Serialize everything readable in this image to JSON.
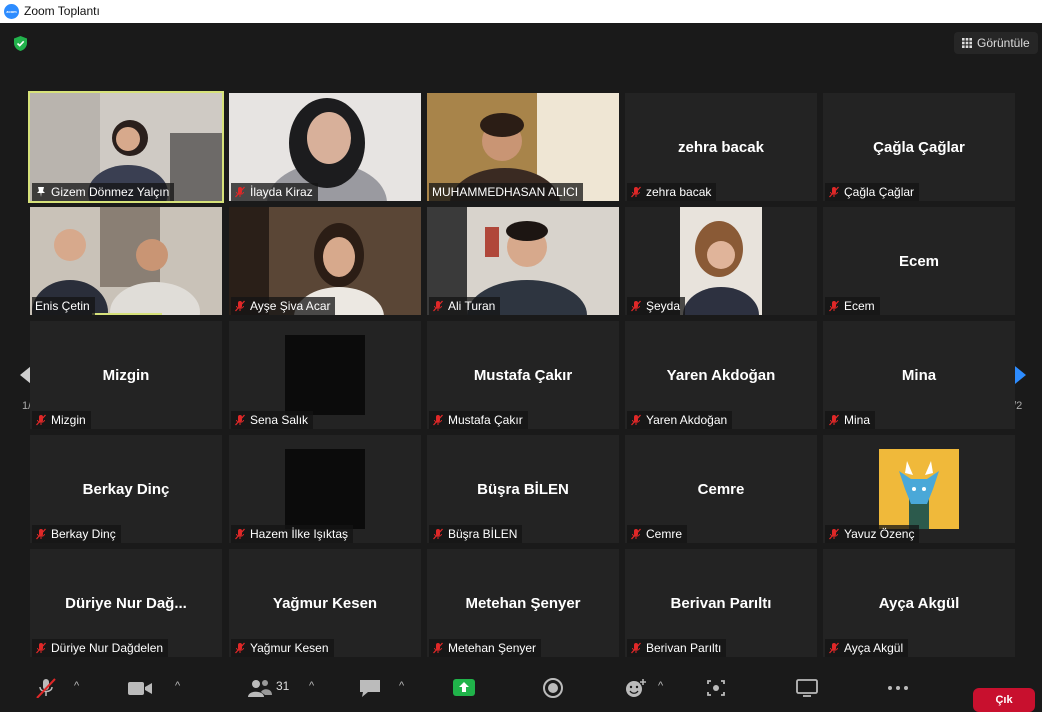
{
  "window": {
    "title": "Zoom Toplantı",
    "logo_text": "zoom"
  },
  "header": {
    "view_label": "Görüntüle"
  },
  "pager": {
    "left_label": "1/2",
    "right_label": "1/2"
  },
  "participants": [
    {
      "display": "",
      "name": "Gizem Dönmez Yalçın",
      "video": true,
      "pinned": true
    },
    {
      "display": "",
      "name": "İlayda Kiraz",
      "video": true
    },
    {
      "display": "",
      "name": "MUHAMMEDHASAN ALICI",
      "video": true
    },
    {
      "display": "zehra bacak",
      "name": "zehra bacak",
      "video": false
    },
    {
      "display": "Çağla Çağlar",
      "name": "Çağla Çağlar",
      "video": false
    },
    {
      "display": "",
      "name": "Enis Çetin",
      "video": true
    },
    {
      "display": "",
      "name": "Ayşe Şiva Acar",
      "video": true
    },
    {
      "display": "",
      "name": "Ali Turan",
      "video": true
    },
    {
      "display": "",
      "name": "Şeyda",
      "video": true
    },
    {
      "display": "Ecem",
      "name": "Ecem",
      "video": false
    },
    {
      "display": "Mizgin",
      "name": "Mizgin",
      "video": false
    },
    {
      "display": "",
      "name": "Sena Salık",
      "video": true
    },
    {
      "display": "Mustafa Çakır",
      "name": "Mustafa Çakır",
      "video": false
    },
    {
      "display": "Yaren Akdoğan",
      "name": "Yaren Akdoğan",
      "video": false
    },
    {
      "display": "Mina",
      "name": "Mina",
      "video": false
    },
    {
      "display": "Berkay Dinç",
      "name": "Berkay Dinç",
      "video": false
    },
    {
      "display": "",
      "name": "Hazem İlke Işıktaş",
      "video": true
    },
    {
      "display": "Büşra BİLEN",
      "name": "Büşra BİLEN",
      "video": false
    },
    {
      "display": "Cemre",
      "name": "Cemre",
      "video": false
    },
    {
      "display": "",
      "name": "Yavuz Özenç",
      "video": true
    },
    {
      "display": "Düriye Nur Dağ...",
      "name": "Düriye Nur Dağdelen",
      "video": false
    },
    {
      "display": "Yağmur Kesen",
      "name": "Yağmur Kesen",
      "video": false
    },
    {
      "display": "Metehan Şenyer",
      "name": "Metehan Şenyer",
      "video": false
    },
    {
      "display": "Berivan Parıltı",
      "name": "Berivan Parıltı",
      "video": false
    },
    {
      "display": "Ayça Akgül",
      "name": "Ayça Akgül",
      "video": false
    }
  ],
  "toolbar": {
    "participant_count": "31",
    "leave_label": "Çık"
  },
  "colors": {
    "active_speaker": "#d7e27a",
    "muted_mic": "#e02828",
    "leave": "#c8102e",
    "nav_arrow": "#2d8cff",
    "share": "#20b34a"
  }
}
